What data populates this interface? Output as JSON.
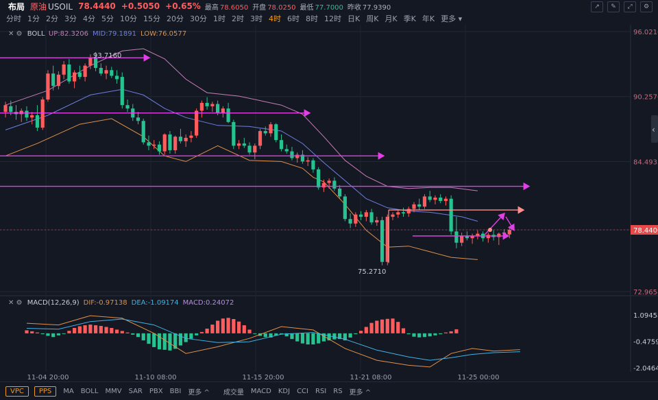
{
  "header": {
    "layout_label": "布局",
    "symbol_name": "原油",
    "symbol_code": "USOIL",
    "price": "78.4440",
    "change": "+0.5050",
    "change_pct": "+0.65%",
    "high_label": "最高",
    "high": "78.6050",
    "open_label": "开盘",
    "open": "78.0250",
    "low_label": "最低",
    "low": "77.7000",
    "prev_close_label": "昨收",
    "prev_close": "77.9390"
  },
  "timeframes": [
    "分时",
    "1分",
    "2分",
    "3分",
    "4分",
    "5分",
    "10分",
    "15分",
    "20分",
    "30分",
    "1时",
    "2时",
    "3时",
    "4时",
    "6时",
    "8时",
    "12时",
    "日K",
    "周K",
    "月K",
    "季K",
    "年K",
    "更多"
  ],
  "active_timeframe": "4时",
  "tool_icons": [
    "cursor-icon",
    "draw-icon",
    "expand-icon",
    "settings-icon"
  ],
  "boll": {
    "label": "BOLL",
    "up_label": "UP:",
    "up": "82.3206",
    "mid_label": "MID:",
    "mid": "79.1891",
    "low_label": "LOW:",
    "low": "76.0577"
  },
  "macd": {
    "label": "MACD(12,26,9)",
    "dif_label": "DIF:",
    "dif": "-0.97138",
    "dea_label": "DEA:",
    "dea": "-1.09174",
    "macd_label": "MACD:",
    "macd": "0.24072"
  },
  "annotations": {
    "high_mark": "93.7160",
    "low_mark": "75.2710"
  },
  "colors": {
    "up": "#ff5d5d",
    "down": "#26c28f",
    "boll_up": "#c77dba",
    "boll_mid": "#6f7fe0",
    "boll_low": "#e0914a",
    "arrow": "#e23fe6",
    "arrow_alt": "#ff8f8f",
    "price_tag": "#e84a4a"
  },
  "bottom": {
    "badges": [
      "VPC",
      "PPS"
    ],
    "indicators_main": [
      "MA",
      "BOLL",
      "MMV",
      "SAR",
      "PBX",
      "BBI"
    ],
    "more_main": "更多",
    "indicators_sub": [
      "成交量",
      "MACD",
      "KDJ",
      "CCI",
      "RSI",
      "RS"
    ],
    "more_sub": "更多"
  },
  "chart_data": {
    "type": "candlestick",
    "price_axis": {
      "ticks": [
        "96.0216",
        "90.2576",
        "84.4935",
        "78.4400",
        "72.9654"
      ],
      "current": "78.4400",
      "range": [
        72.9654,
        96.0216
      ]
    },
    "macd_axis": {
      "ticks": [
        "1.09458",
        "-0.47594",
        "-2.04646"
      ],
      "range": [
        -2.04646,
        1.09458
      ]
    },
    "x_labels": [
      "11-04 20:00",
      "11-10 08:00",
      "11-15 20:00",
      "11-21 08:00",
      "11-25 00:00"
    ],
    "candles": [
      {
        "o": 88.9,
        "h": 89.8,
        "l": 88.4,
        "c": 89.5
      },
      {
        "o": 89.4,
        "h": 89.9,
        "l": 88.6,
        "c": 88.9
      },
      {
        "o": 88.9,
        "h": 89.5,
        "l": 88.2,
        "c": 88.7
      },
      {
        "o": 88.7,
        "h": 89.2,
        "l": 88.0,
        "c": 89.0
      },
      {
        "o": 89.0,
        "h": 89.4,
        "l": 88.1,
        "c": 88.4
      },
      {
        "o": 88.4,
        "h": 88.9,
        "l": 87.8,
        "c": 88.6
      },
      {
        "o": 88.6,
        "h": 89.5,
        "l": 87.2,
        "c": 87.5
      },
      {
        "o": 87.5,
        "h": 90.2,
        "l": 87.3,
        "c": 90.0
      },
      {
        "o": 90.0,
        "h": 92.6,
        "l": 89.8,
        "c": 92.3
      },
      {
        "o": 92.3,
        "h": 93.0,
        "l": 90.8,
        "c": 91.2
      },
      {
        "o": 91.2,
        "h": 92.5,
        "l": 90.9,
        "c": 92.2
      },
      {
        "o": 92.2,
        "h": 93.4,
        "l": 91.8,
        "c": 93.1
      },
      {
        "o": 93.1,
        "h": 93.6,
        "l": 91.4,
        "c": 91.6
      },
      {
        "o": 91.6,
        "h": 92.6,
        "l": 91.0,
        "c": 92.4
      },
      {
        "o": 92.4,
        "h": 93.0,
        "l": 91.8,
        "c": 92.0
      },
      {
        "o": 92.0,
        "h": 93.2,
        "l": 91.6,
        "c": 93.0
      },
      {
        "o": 93.0,
        "h": 94.0,
        "l": 92.7,
        "c": 93.7
      },
      {
        "o": 93.7,
        "h": 94.2,
        "l": 92.5,
        "c": 92.8
      },
      {
        "o": 92.8,
        "h": 93.2,
        "l": 92.1,
        "c": 92.3
      },
      {
        "o": 92.3,
        "h": 93.0,
        "l": 91.8,
        "c": 92.6
      },
      {
        "o": 92.6,
        "h": 92.9,
        "l": 91.9,
        "c": 92.1
      },
      {
        "o": 92.1,
        "h": 92.6,
        "l": 91.4,
        "c": 91.8
      },
      {
        "o": 92.0,
        "h": 92.4,
        "l": 89.2,
        "c": 89.5
      },
      {
        "o": 89.5,
        "h": 90.0,
        "l": 88.9,
        "c": 89.2
      },
      {
        "o": 89.2,
        "h": 89.6,
        "l": 88.1,
        "c": 88.4
      },
      {
        "o": 88.4,
        "h": 88.9,
        "l": 87.8,
        "c": 88.1
      },
      {
        "o": 88.1,
        "h": 88.3,
        "l": 86.0,
        "c": 86.2
      },
      {
        "o": 86.2,
        "h": 86.8,
        "l": 85.5,
        "c": 85.9
      },
      {
        "o": 85.9,
        "h": 86.4,
        "l": 85.6,
        "c": 86.0
      },
      {
        "o": 86.0,
        "h": 86.3,
        "l": 85.1,
        "c": 85.4
      },
      {
        "o": 85.4,
        "h": 87.0,
        "l": 85.1,
        "c": 86.9
      },
      {
        "o": 86.9,
        "h": 87.2,
        "l": 85.2,
        "c": 85.5
      },
      {
        "o": 85.5,
        "h": 86.8,
        "l": 85.2,
        "c": 86.7
      },
      {
        "o": 86.7,
        "h": 87.4,
        "l": 86.1,
        "c": 86.3
      },
      {
        "o": 86.3,
        "h": 86.9,
        "l": 85.8,
        "c": 86.6
      },
      {
        "o": 86.6,
        "h": 87.2,
        "l": 86.2,
        "c": 86.8
      },
      {
        "o": 86.8,
        "h": 89.2,
        "l": 86.6,
        "c": 89.0
      },
      {
        "o": 89.0,
        "h": 89.9,
        "l": 88.4,
        "c": 89.7
      },
      {
        "o": 89.7,
        "h": 90.2,
        "l": 89.1,
        "c": 89.4
      },
      {
        "o": 89.4,
        "h": 89.8,
        "l": 88.9,
        "c": 89.6
      },
      {
        "o": 89.6,
        "h": 89.9,
        "l": 88.6,
        "c": 88.8
      },
      {
        "o": 88.8,
        "h": 89.4,
        "l": 88.4,
        "c": 89.2
      },
      {
        "o": 89.2,
        "h": 89.7,
        "l": 87.9,
        "c": 88.0
      },
      {
        "o": 88.0,
        "h": 88.2,
        "l": 85.6,
        "c": 85.9
      },
      {
        "o": 85.9,
        "h": 86.4,
        "l": 85.6,
        "c": 86.1
      },
      {
        "o": 86.1,
        "h": 86.6,
        "l": 85.7,
        "c": 85.9
      },
      {
        "o": 85.9,
        "h": 86.2,
        "l": 85.1,
        "c": 85.3
      },
      {
        "o": 85.3,
        "h": 86.1,
        "l": 84.7,
        "c": 85.9
      },
      {
        "o": 85.9,
        "h": 87.4,
        "l": 85.6,
        "c": 87.2
      },
      {
        "o": 87.2,
        "h": 87.6,
        "l": 86.8,
        "c": 87.0
      },
      {
        "o": 87.0,
        "h": 88.0,
        "l": 86.7,
        "c": 87.8
      },
      {
        "o": 87.8,
        "h": 87.9,
        "l": 86.2,
        "c": 86.4
      },
      {
        "o": 86.4,
        "h": 86.9,
        "l": 85.4,
        "c": 85.6
      },
      {
        "o": 85.6,
        "h": 86.0,
        "l": 85.2,
        "c": 85.4
      },
      {
        "o": 85.4,
        "h": 85.8,
        "l": 84.6,
        "c": 84.8
      },
      {
        "o": 84.8,
        "h": 85.3,
        "l": 84.4,
        "c": 85.1
      },
      {
        "o": 85.1,
        "h": 85.5,
        "l": 84.3,
        "c": 84.5
      },
      {
        "o": 84.5,
        "h": 84.9,
        "l": 84.1,
        "c": 84.6
      },
      {
        "o": 84.6,
        "h": 84.8,
        "l": 83.5,
        "c": 83.8
      },
      {
        "o": 83.8,
        "h": 84.0,
        "l": 82.0,
        "c": 82.2
      },
      {
        "o": 82.2,
        "h": 82.9,
        "l": 81.8,
        "c": 82.6
      },
      {
        "o": 82.6,
        "h": 83.0,
        "l": 82.1,
        "c": 82.8
      },
      {
        "o": 82.8,
        "h": 83.1,
        "l": 81.9,
        "c": 82.1
      },
      {
        "o": 82.1,
        "h": 82.4,
        "l": 81.2,
        "c": 81.4
      },
      {
        "o": 81.4,
        "h": 81.6,
        "l": 79.2,
        "c": 79.4
      },
      {
        "o": 79.4,
        "h": 79.9,
        "l": 78.6,
        "c": 79.0
      },
      {
        "o": 79.0,
        "h": 80.0,
        "l": 78.7,
        "c": 79.8
      },
      {
        "o": 79.8,
        "h": 80.1,
        "l": 79.3,
        "c": 79.6
      },
      {
        "o": 79.6,
        "h": 80.2,
        "l": 79.2,
        "c": 80.0
      },
      {
        "o": 80.0,
        "h": 80.3,
        "l": 78.9,
        "c": 79.1
      },
      {
        "o": 79.1,
        "h": 79.6,
        "l": 78.8,
        "c": 79.3
      },
      {
        "o": 79.3,
        "h": 79.6,
        "l": 75.3,
        "c": 75.6
      },
      {
        "o": 75.6,
        "h": 79.8,
        "l": 75.3,
        "c": 79.6
      },
      {
        "o": 79.6,
        "h": 80.0,
        "l": 79.3,
        "c": 79.8
      },
      {
        "o": 79.8,
        "h": 80.2,
        "l": 79.5,
        "c": 80.0
      },
      {
        "o": 80.0,
        "h": 80.4,
        "l": 79.6,
        "c": 79.9
      },
      {
        "o": 79.9,
        "h": 80.5,
        "l": 79.6,
        "c": 80.3
      },
      {
        "o": 80.3,
        "h": 80.9,
        "l": 80.0,
        "c": 80.7
      },
      {
        "o": 80.7,
        "h": 81.2,
        "l": 80.2,
        "c": 80.5
      },
      {
        "o": 80.5,
        "h": 81.6,
        "l": 80.3,
        "c": 81.4
      },
      {
        "o": 81.4,
        "h": 81.9,
        "l": 80.9,
        "c": 81.1
      },
      {
        "o": 81.1,
        "h": 81.5,
        "l": 80.7,
        "c": 81.3
      },
      {
        "o": 81.3,
        "h": 81.6,
        "l": 80.8,
        "c": 81.0
      },
      {
        "o": 81.0,
        "h": 81.4,
        "l": 80.6,
        "c": 81.2
      },
      {
        "o": 81.2,
        "h": 81.5,
        "l": 78.0,
        "c": 78.3
      },
      {
        "o": 78.3,
        "h": 79.6,
        "l": 76.8,
        "c": 77.3
      },
      {
        "o": 77.3,
        "h": 78.2,
        "l": 77.0,
        "c": 77.9
      },
      {
        "o": 77.9,
        "h": 78.3,
        "l": 77.5,
        "c": 77.7
      },
      {
        "o": 77.7,
        "h": 78.1,
        "l": 77.2,
        "c": 77.9
      },
      {
        "o": 77.9,
        "h": 78.4,
        "l": 77.6,
        "c": 78.1
      },
      {
        "o": 78.1,
        "h": 78.3,
        "l": 77.4,
        "c": 77.7
      },
      {
        "o": 77.7,
        "h": 78.2,
        "l": 77.3,
        "c": 78.0
      },
      {
        "o": 78.0,
        "h": 78.4,
        "l": 77.5,
        "c": 77.8
      },
      {
        "o": 77.8,
        "h": 78.2,
        "l": 77.1,
        "c": 78.1
      },
      {
        "o": 78.1,
        "h": 78.5,
        "l": 77.8,
        "c": 78.2
      },
      {
        "o": 78.03,
        "h": 78.61,
        "l": 77.7,
        "c": 78.44
      }
    ],
    "boll_upper": [
      [
        0,
        89.5
      ],
      [
        8,
        90.8
      ],
      [
        16,
        93.0
      ],
      [
        22,
        94.3
      ],
      [
        26,
        94.5
      ],
      [
        30,
        93.6
      ],
      [
        34,
        91.8
      ],
      [
        38,
        90.6
      ],
      [
        44,
        90.3
      ],
      [
        52,
        89.5
      ],
      [
        56,
        88.7
      ],
      [
        60,
        86.7
      ],
      [
        64,
        84.6
      ],
      [
        68,
        83.2
      ],
      [
        72,
        82.3
      ],
      [
        76,
        82.1
      ],
      [
        80,
        82.2
      ],
      [
        84,
        82.2
      ],
      [
        89,
        81.9
      ]
    ],
    "boll_mid": [
      [
        0,
        87.3
      ],
      [
        8,
        88.6
      ],
      [
        16,
        90.4
      ],
      [
        22,
        90.9
      ],
      [
        26,
        90.4
      ],
      [
        30,
        89.2
      ],
      [
        34,
        88.4
      ],
      [
        40,
        87.7
      ],
      [
        46,
        87.6
      ],
      [
        52,
        87.2
      ],
      [
        56,
        86.1
      ],
      [
        60,
        84.4
      ],
      [
        64,
        82.8
      ],
      [
        68,
        81.2
      ],
      [
        72,
        80.4
      ],
      [
        76,
        80.1
      ],
      [
        80,
        80.0
      ],
      [
        86,
        79.6
      ],
      [
        89,
        79.2
      ]
    ],
    "boll_lower": [
      [
        0,
        85.0
      ],
      [
        6,
        86.1
      ],
      [
        14,
        87.8
      ],
      [
        20,
        88.3
      ],
      [
        26,
        86.7
      ],
      [
        30,
        85.0
      ],
      [
        34,
        84.5
      ],
      [
        40,
        85.9
      ],
      [
        46,
        84.6
      ],
      [
        52,
        84.5
      ],
      [
        56,
        83.9
      ],
      [
        58,
        83.1
      ],
      [
        60,
        82.7
      ],
      [
        64,
        80.7
      ],
      [
        68,
        78.4
      ],
      [
        72,
        76.9
      ],
      [
        76,
        77.0
      ],
      [
        80,
        76.5
      ],
      [
        84,
        76.0
      ],
      [
        89,
        75.8
      ]
    ],
    "macd_hist": [
      0.18,
      0.12,
      0.05,
      -0.05,
      -0.15,
      -0.22,
      -0.12,
      -0.02,
      0.15,
      0.32,
      0.42,
      0.48,
      0.52,
      0.48,
      0.44,
      0.38,
      0.32,
      0.22,
      0.14,
      0.05,
      -0.08,
      -0.22,
      -0.42,
      -0.62,
      -0.82,
      -0.95,
      -0.98,
      -1.02,
      -0.92,
      -0.72,
      -0.52,
      -0.32,
      -0.12,
      0.08,
      0.28,
      0.52,
      0.75,
      0.88,
      0.92,
      0.85,
      0.7,
      0.48,
      0.22,
      -0.04,
      -0.15,
      -0.22,
      -0.25,
      -0.12,
      -0.05,
      -0.18,
      -0.34,
      -0.48,
      -0.6,
      -0.66,
      -0.66,
      -0.6,
      -0.48,
      -0.42,
      -0.36,
      -0.34,
      -0.42,
      -0.25,
      -0.05,
      0.15,
      0.38,
      0.62,
      0.75,
      0.82,
      0.86,
      0.88,
      0.68,
      0.3,
      -0.05,
      -0.2,
      -0.24,
      -0.22,
      -0.18,
      -0.12,
      -0.05,
      0.05,
      0.12,
      0.24
    ],
    "macd_dif": [
      [
        0,
        0.6
      ],
      [
        6,
        0.5
      ],
      [
        12,
        1.05
      ],
      [
        18,
        0.9
      ],
      [
        24,
        0.0
      ],
      [
        30,
        -1.2
      ],
      [
        36,
        -0.8
      ],
      [
        42,
        -0.3
      ],
      [
        48,
        0.4
      ],
      [
        54,
        0.2
      ],
      [
        60,
        -0.9
      ],
      [
        66,
        -1.6
      ],
      [
        72,
        -1.9
      ],
      [
        76,
        -2.0
      ],
      [
        80,
        -1.2
      ],
      [
        84,
        -0.9
      ],
      [
        88,
        -1.05
      ],
      [
        93,
        -0.97
      ]
    ],
    "macd_dea": [
      [
        0,
        0.3
      ],
      [
        6,
        0.25
      ],
      [
        12,
        0.7
      ],
      [
        18,
        0.85
      ],
      [
        24,
        0.5
      ],
      [
        30,
        -0.3
      ],
      [
        36,
        -0.55
      ],
      [
        42,
        -0.5
      ],
      [
        48,
        -0.05
      ],
      [
        54,
        0.05
      ],
      [
        60,
        -0.35
      ],
      [
        66,
        -1.0
      ],
      [
        72,
        -1.4
      ],
      [
        76,
        -1.6
      ],
      [
        80,
        -1.45
      ],
      [
        84,
        -1.25
      ],
      [
        88,
        -1.15
      ],
      [
        93,
        -1.09
      ]
    ]
  }
}
